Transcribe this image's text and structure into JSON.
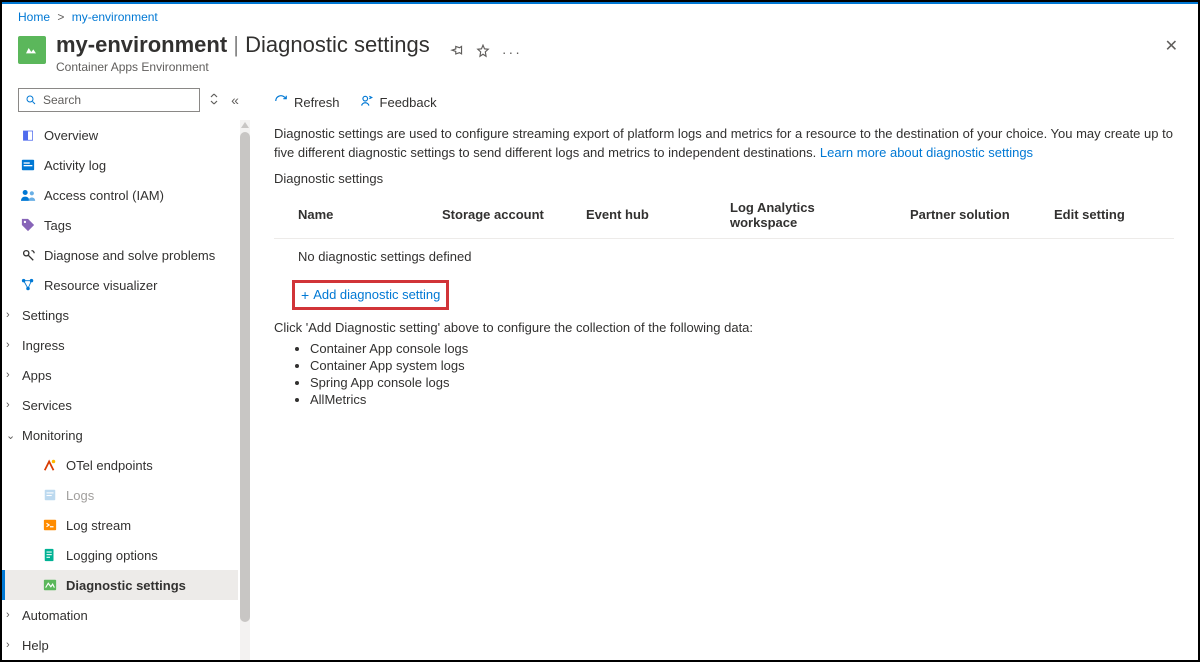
{
  "breadcrumb": {
    "home": "Home",
    "resource": "my-environment"
  },
  "header": {
    "resource_name": "my-environment",
    "page_title": "Diagnostic settings",
    "subtitle": "Container Apps Environment"
  },
  "sidebar": {
    "search_placeholder": "Search",
    "items": {
      "overview": "Overview",
      "activity": "Activity log",
      "access": "Access control (IAM)",
      "tags": "Tags",
      "diagnose": "Diagnose and solve problems",
      "visualizer": "Resource visualizer",
      "settings": "Settings",
      "ingress": "Ingress",
      "apps": "Apps",
      "services": "Services",
      "monitoring": "Monitoring",
      "otel": "OTel endpoints",
      "logs": "Logs",
      "logstream": "Log stream",
      "logopt": "Logging options",
      "diagsettings": "Diagnostic settings",
      "automation": "Automation",
      "help": "Help"
    }
  },
  "toolbar": {
    "refresh": "Refresh",
    "feedback": "Feedback"
  },
  "main": {
    "description": "Diagnostic settings are used to configure streaming export of platform logs and metrics for a resource to the destination of your choice. You may create up to five different diagnostic settings to send different logs and metrics to independent destinations. ",
    "learn_more": "Learn more about diagnostic settings",
    "section_label": "Diagnostic settings",
    "columns": {
      "name": "Name",
      "storage": "Storage account",
      "eventhub": "Event hub",
      "law": "Log Analytics workspace",
      "partner": "Partner solution",
      "edit": "Edit setting"
    },
    "empty_row": "No diagnostic settings defined",
    "add_button": "Add diagnostic setting",
    "hint": "Click 'Add Diagnostic setting' above to configure the collection of the following data:",
    "bullets": [
      "Container App console logs",
      "Container App system logs",
      "Spring App console logs",
      "AllMetrics"
    ]
  }
}
